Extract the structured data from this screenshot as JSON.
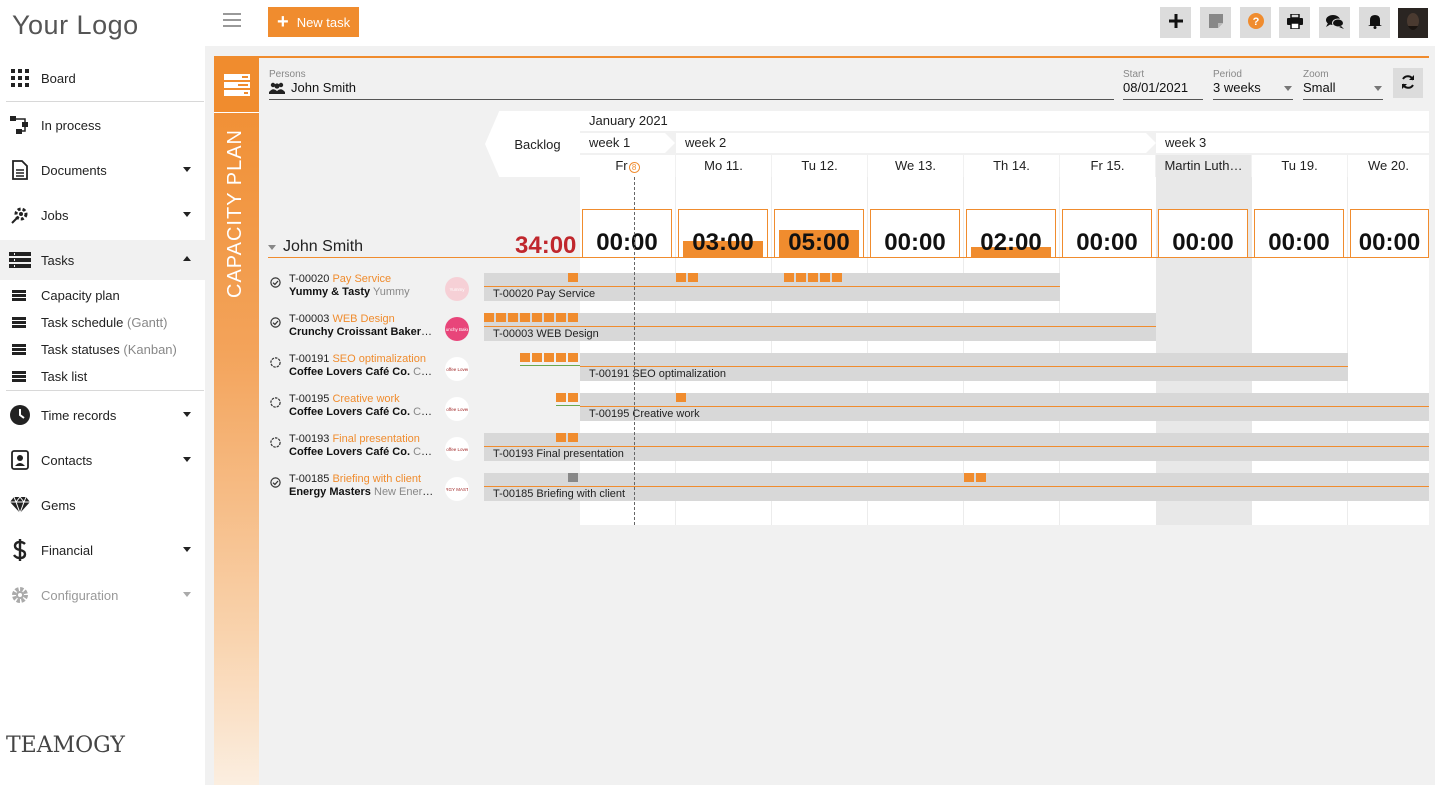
{
  "sidebar": {
    "logo": "Your Logo",
    "items": [
      {
        "label": "Board"
      },
      {
        "label": "In process"
      },
      {
        "label": "Documents"
      },
      {
        "label": "Jobs"
      },
      {
        "label": "Tasks"
      },
      {
        "label": "Time records"
      },
      {
        "label": "Contacts"
      },
      {
        "label": "Gems"
      },
      {
        "label": "Financial"
      },
      {
        "label": "Configuration"
      }
    ],
    "sub_items": [
      {
        "label": "Capacity plan",
        "muted": ""
      },
      {
        "label": "Task schedule",
        "muted": "(Gantt)"
      },
      {
        "label": "Task statuses",
        "muted": "(Kanban)"
      },
      {
        "label": "Task list",
        "muted": ""
      }
    ],
    "footer_logo": "TEAMOGY"
  },
  "topbar": {
    "new_task_label": "New task",
    "buttons": [
      "plus-icon",
      "note-icon",
      "help-icon",
      "print-icon",
      "chat-icon",
      "bell-icon"
    ],
    "accent": "#f08c2e"
  },
  "panel": {
    "vertical_title": "CAPACITY PLAN"
  },
  "filters": {
    "persons_label": "Persons",
    "persons_value": "John Smith",
    "start_label": "Start",
    "start_value": "08/01/2021",
    "period_label": "Period",
    "period_value": "3 weeks",
    "zoom_label": "Zoom",
    "zoom_value": "Small"
  },
  "timeline": {
    "month": "January 2021",
    "backlog": "Backlog",
    "weeks": [
      "week 1",
      "week 2",
      "week 3"
    ],
    "days": [
      "Fr",
      "Mo 11.",
      "Tu 12.",
      "We 13.",
      "Th 14.",
      "Fr 15.",
      "Martin Luth…",
      "Tu 19.",
      "We 20."
    ],
    "today_badge": "8"
  },
  "person": {
    "name": "John Smith",
    "total": "34:00",
    "hours": [
      {
        "text": "00:00",
        "load": 0
      },
      {
        "text": "03:00",
        "load": 0.375
      },
      {
        "text": "05:00",
        "load": 0.625
      },
      {
        "text": "00:00",
        "load": 0
      },
      {
        "text": "02:00",
        "load": 0.25
      },
      {
        "text": "00:00",
        "load": 0
      },
      {
        "text": "00:00",
        "load": 0
      },
      {
        "text": "00:00",
        "load": 0
      },
      {
        "text": "00:00",
        "load": 0
      }
    ]
  },
  "tasks": [
    {
      "code": "T-00020",
      "title": "Pay Service",
      "client": "Yummy & Tasty",
      "project": "Yummy",
      "done": true,
      "logo": "Yummy",
      "logo_color": "#f6d0d6",
      "bar_label": "T-00020 Pay Service"
    },
    {
      "code": "T-00003",
      "title": "WEB Design",
      "client": "Crunchy Croissant Bakery",
      "project": "...",
      "done": true,
      "logo": "Crunchy Bakery",
      "logo_color": "#e8457a",
      "bar_label": "T-00003 WEB Design"
    },
    {
      "code": "T-00191",
      "title": "SEO optimalization",
      "client": "Coffee Lovers Café Co.",
      "project": "Cof...",
      "done": false,
      "logo": "Coffee Lovers",
      "logo_color": "#ffffff",
      "bar_label": "T-00191 SEO optimalization"
    },
    {
      "code": "T-00195",
      "title": "Creative work",
      "client": "Coffee Lovers Café Co.",
      "project": "Cof...",
      "done": false,
      "logo": "Coffee Lovers",
      "logo_color": "#ffffff",
      "bar_label": "T-00195 Creative work"
    },
    {
      "code": "T-00193",
      "title": "Final presentation",
      "client": "Coffee Lovers Café Co.",
      "project": "Cof...",
      "done": false,
      "logo": "Coffee Lovers",
      "logo_color": "#ffffff",
      "bar_label": "T-00193 Final presentation"
    },
    {
      "code": "T-00185",
      "title": "Briefing with client",
      "client": "Energy Masters",
      "project": "New Energ...",
      "done": true,
      "logo": "ENERGY MASTERS",
      "logo_color": "#ffffff",
      "bar_label": "T-00185 Briefing with client"
    }
  ]
}
